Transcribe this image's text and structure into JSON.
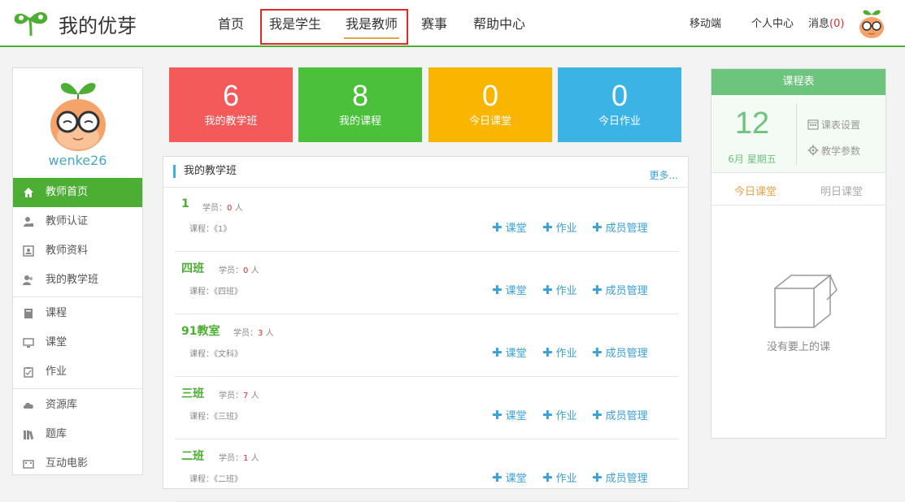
{
  "header": {
    "logo_text": "我的优芽",
    "nav": [
      "首页",
      "我是学生",
      "我是教师",
      "赛事",
      "帮助中心"
    ],
    "mobile": "移动端",
    "user_center": "个人中心",
    "messages_label": "消息",
    "messages_count": "(0)"
  },
  "sidebar": {
    "username": "wenke26",
    "items": [
      {
        "label": "教师首页",
        "icon": "home-icon"
      },
      {
        "label": "教师认证",
        "icon": "user-badge-icon"
      },
      {
        "label": "教师资料",
        "icon": "profile-card-icon"
      },
      {
        "label": "我的教学班",
        "icon": "group-icon"
      },
      {
        "label": "课程",
        "icon": "book-icon"
      },
      {
        "label": "课堂",
        "icon": "monitor-icon"
      },
      {
        "label": "作业",
        "icon": "clipboard-icon"
      },
      {
        "label": "资源库",
        "icon": "cloud-icon"
      },
      {
        "label": "题库",
        "icon": "books-icon"
      },
      {
        "label": "互动电影",
        "icon": "film-icon"
      }
    ]
  },
  "stats": [
    {
      "value": "6",
      "label": "我的教学班",
      "color": "#f55a5a"
    },
    {
      "value": "8",
      "label": "我的课程",
      "color": "#4bc13b"
    },
    {
      "value": "0",
      "label": "今日课堂",
      "color": "#f9b500"
    },
    {
      "value": "0",
      "label": "今日作业",
      "color": "#3bb4e5"
    }
  ],
  "classes": {
    "title": "我的教学班",
    "more": "更多...",
    "student_label": "学员：",
    "unit": "人",
    "course_label": "课程：",
    "actions": [
      "课堂",
      "作业",
      "成员管理"
    ],
    "rows": [
      {
        "name": "1",
        "count": "0",
        "course": "《1》"
      },
      {
        "name": "四班",
        "count": "0",
        "course": "《四班》"
      },
      {
        "name": "91教室",
        "count": "3",
        "course": "《文科》"
      },
      {
        "name": "三班",
        "count": "7",
        "course": "《三班》"
      },
      {
        "name": "二班",
        "count": "1",
        "course": "《二班》"
      }
    ]
  },
  "schedule": {
    "title": "课程表",
    "day": "12",
    "weekday": "6月 星期五",
    "settings": "课表设置",
    "params": "教学参数",
    "tab_today": "今日课堂",
    "tab_tomorrow": "明日课堂",
    "empty": "没有要上的课"
  }
}
